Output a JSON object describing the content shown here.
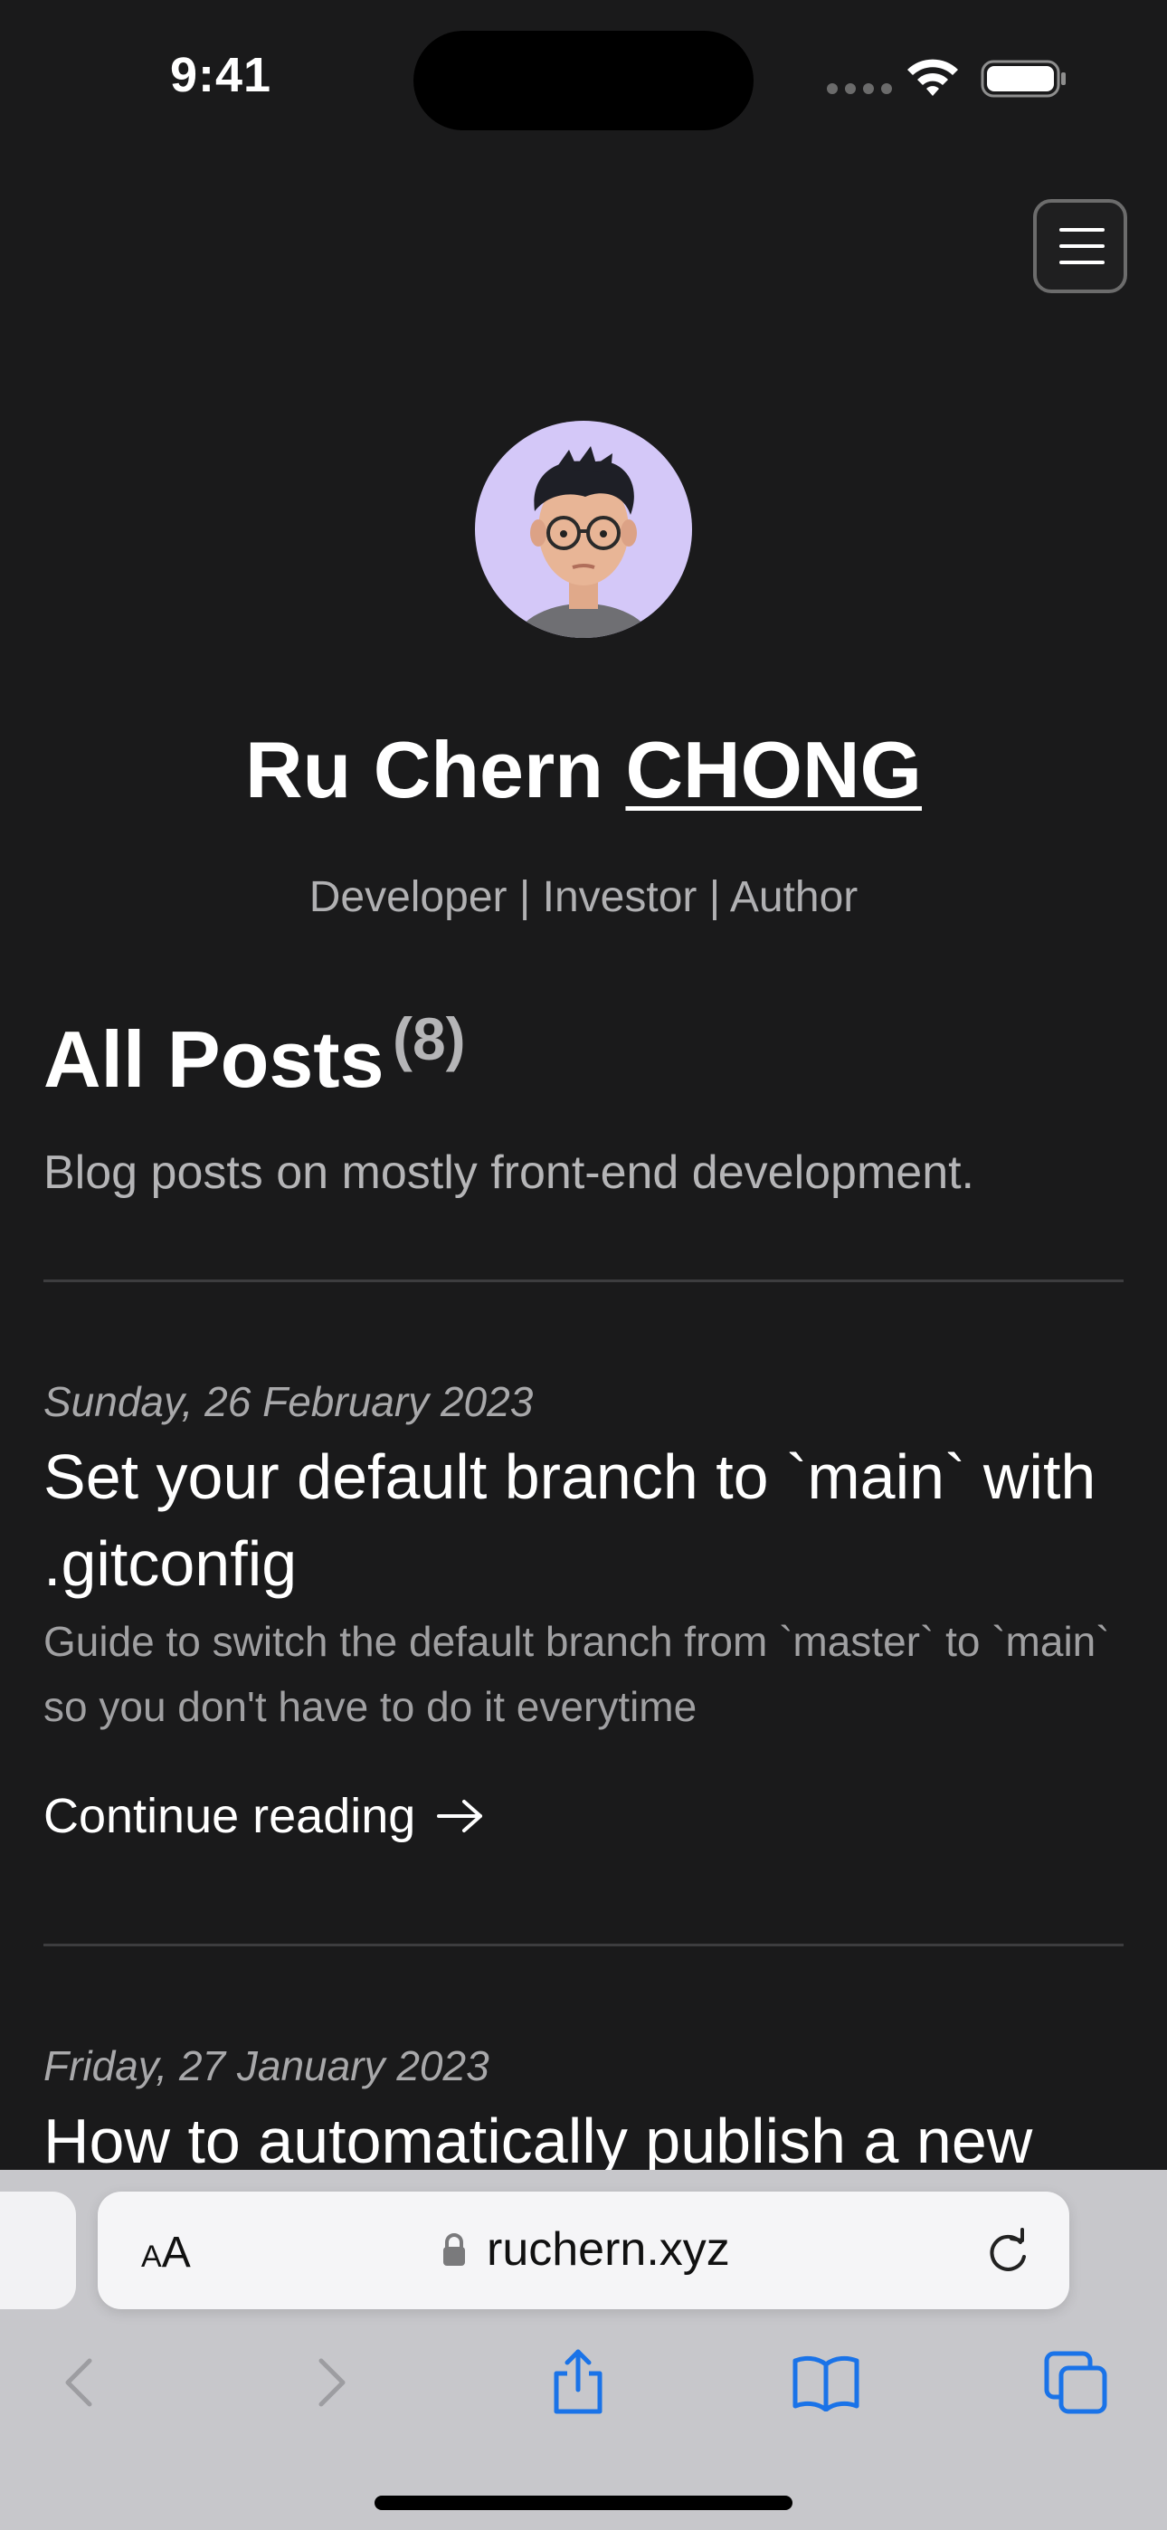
{
  "status_bar": {
    "time": "9:41"
  },
  "header": {
    "menu_icon": "hamburger-menu-icon"
  },
  "profile": {
    "name_first": "Ru Chern ",
    "name_last": "CHONG",
    "tagline": "Developer | Investor | Author",
    "avatar": "memoji-avatar"
  },
  "posts_section": {
    "heading": "All Posts",
    "count": "(8)",
    "description": "Blog posts on mostly front-end development."
  },
  "posts": [
    {
      "date": "Sunday, 26 February 2023",
      "title": "Set your default branch to `main` with .gitconfig",
      "excerpt": "Guide to switch the default branch from `master` to `main` so you don't have to do it everytime",
      "link_label": "Continue reading"
    },
    {
      "date": "Friday, 27 January 2023",
      "title": "How to automatically publish a new"
    }
  ],
  "browser": {
    "text_size_small": "A",
    "text_size_big": "A",
    "url": "ruchern.xyz",
    "toolbar_icons": [
      "back-icon",
      "forward-icon",
      "share-icon",
      "bookmarks-icon",
      "tabs-icon"
    ],
    "accent_color": "#1a73e8"
  }
}
